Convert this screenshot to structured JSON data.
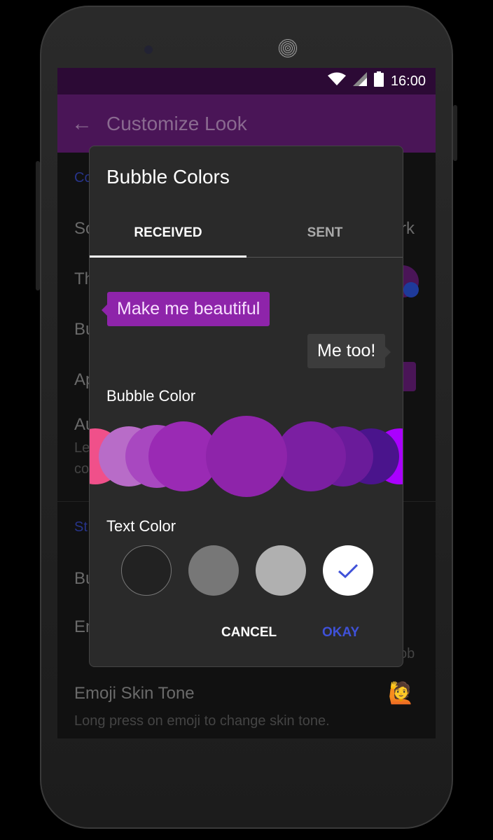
{
  "status_bar": {
    "time": "16:00",
    "icons": [
      "wifi-icon",
      "signal-icon",
      "battery-icon"
    ]
  },
  "toolbar": {
    "title": "Customize Look",
    "back_icon": "arrow-left-icon"
  },
  "background_fragments": {
    "h1": "Co",
    "r1": "So",
    "r1_right": "rk",
    "r2": "Th",
    "r3": "Bu",
    "r4": "Ap",
    "r5": "Au",
    "r5_sub1": "Le",
    "r5_sub2": "co",
    "h2": "St",
    "r6": "Bu",
    "r7": "Em",
    "r7_right": "ob",
    "r8_title": "Emoji Skin Tone",
    "r8_sub": "Long press on emoji to change skin tone."
  },
  "dialog": {
    "title": "Bubble Colors",
    "tabs": [
      {
        "label": "RECEIVED",
        "selected": true
      },
      {
        "label": "SENT",
        "selected": false
      }
    ],
    "preview": {
      "received": "Make me beautiful",
      "sent": "Me too!"
    },
    "bubble_color_label": "Bubble Color",
    "bubble_colors": [
      "#f0508a",
      "#b86cc8",
      "#a848c0",
      "#9a2ab4",
      "#8e24aa",
      "#7b1fa2",
      "#6a1b9a",
      "#4a148c",
      "#aa00ff"
    ],
    "selected_bubble_color": "#8e24aa",
    "text_color_label": "Text Color",
    "text_colors": [
      "#222222",
      "#777777",
      "#b0b0b0",
      "#ffffff"
    ],
    "selected_text_color": "#ffffff",
    "cancel": "CANCEL",
    "okay": "OKAY"
  },
  "colors": {
    "accent": "#3f51d8",
    "primary": "#4a1557"
  }
}
